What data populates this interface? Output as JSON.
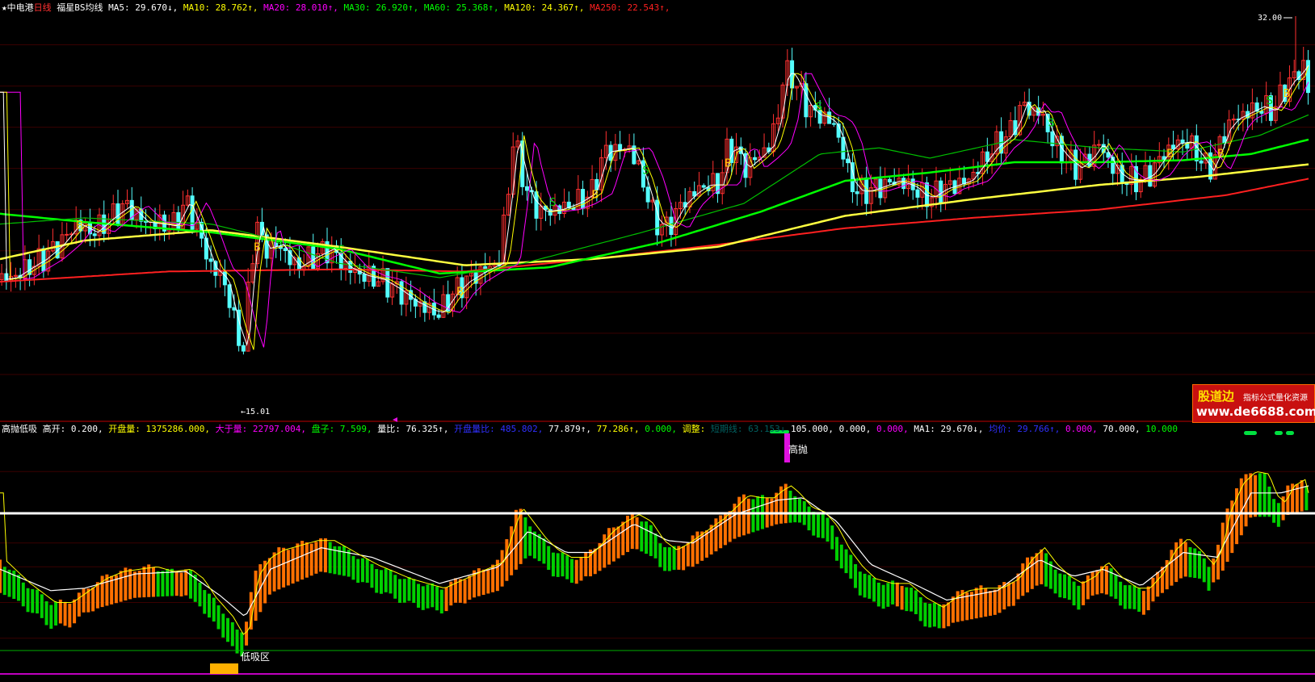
{
  "main_header": {
    "star": "★",
    "stock": "中电港",
    "period": "日线",
    "indicator": "福星BS均线",
    "items": [
      {
        "label": "MA5: 29.670↓,",
        "color": "#ffffff"
      },
      {
        "label": "MA10: 28.762↑,",
        "color": "#ffff00"
      },
      {
        "label": "MA20: 28.010↑,",
        "color": "#ff00ff"
      },
      {
        "label": "MA30: 26.920↑,",
        "color": "#00ff00"
      },
      {
        "label": "MA60: 25.368↑,",
        "color": "#00ff00"
      },
      {
        "label": "MA120: 24.367↑,",
        "color": "#ffff00"
      },
      {
        "label": "MA250: 22.543↑,",
        "color": "#ff2020"
      }
    ]
  },
  "sub_header": {
    "items": [
      {
        "label": "高抛低吸",
        "color": "#ffffff"
      },
      {
        "label": " 高开: 0.200,",
        "color": "#ffffff"
      },
      {
        "label": " 开盘量: 1375286.000,",
        "color": "#ffff00"
      },
      {
        "label": " 大于量: 22797.004,",
        "color": "#ff00ff"
      },
      {
        "label": " 盘子: 7.599,",
        "color": "#00ff00"
      },
      {
        "label": " 量比: 76.325↑,",
        "color": "#ffffff"
      },
      {
        "label": " 开盘量比: 485.802,",
        "color": "#3030ff"
      },
      {
        "label": " 77.879↑,",
        "color": "#ffffff"
      },
      {
        "label": " 77.286↑,",
        "color": "#ffff00"
      },
      {
        "label": " 0.000,",
        "color": "#00ff00"
      },
      {
        "label": " 调整:",
        "color": "#ffff00"
      },
      {
        "label": " 短期线: 63.153↓",
        "color": "#006060"
      },
      {
        "label": " 105.000,",
        "color": "#ffffff"
      },
      {
        "label": " 0.000,",
        "color": "#ffffff"
      },
      {
        "label": " 0.000,",
        "color": "#ff00ff"
      },
      {
        "label": " MA1: 29.670↓,",
        "color": "#ffffff"
      },
      {
        "label": " 均价: 29.766↑,",
        "color": "#3030ff"
      },
      {
        "label": " 0.000,",
        "color": "#ff00ff"
      },
      {
        "label": " 70.000,",
        "color": "#ffffff"
      },
      {
        "label": " 10.000",
        "color": "#00ff00"
      }
    ]
  },
  "watermark": {
    "line1": "股道边",
    "line2": "指标公式量化资源",
    "line3": "www.de6688.com"
  },
  "chart_data": [
    {
      "type": "candlestick",
      "title": "福星BS均线",
      "ylim": [
        14,
        33
      ],
      "annotations": {
        "high_label": "32.00",
        "low_label": "←15.01",
        "buy_marker": "B",
        "sell_marker": "S"
      },
      "series": [
        {
          "name": "MA5",
          "value": 29.67,
          "color": "#ffffff"
        },
        {
          "name": "MA10",
          "value": 28.762,
          "color": "#ffff00"
        },
        {
          "name": "MA20",
          "value": 28.01,
          "color": "#ff00ff"
        },
        {
          "name": "MA30",
          "value": 26.92,
          "color": "#00ff00"
        },
        {
          "name": "MA60",
          "value": 25.368,
          "color": "#00ff00"
        },
        {
          "name": "MA120",
          "value": 24.367,
          "color": "#ffff00"
        },
        {
          "name": "MA250",
          "value": 22.543,
          "color": "#ff2020"
        }
      ],
      "close_path": [
        [
          0,
          20.6
        ],
        [
          15,
          20.7
        ],
        [
          30,
          21.1
        ],
        [
          50,
          21.6
        ],
        [
          70,
          22.3
        ],
        [
          90,
          23.3
        ],
        [
          110,
          22.9
        ],
        [
          130,
          23.6
        ],
        [
          150,
          24.2
        ],
        [
          170,
          23.4
        ],
        [
          190,
          23.3
        ],
        [
          205,
          23.2
        ],
        [
          220,
          24.4
        ],
        [
          235,
          22.9
        ],
        [
          250,
          21.2
        ],
        [
          265,
          20.6
        ],
        [
          278,
          18.4
        ],
        [
          288,
          17.2
        ],
        [
          297,
          21.6
        ],
        [
          305,
          23.3
        ],
        [
          312,
          22.1
        ],
        [
          330,
          22.3
        ],
        [
          350,
          21.2
        ],
        [
          370,
          21.7
        ],
        [
          390,
          22.1
        ],
        [
          410,
          21.2
        ],
        [
          430,
          20.8
        ],
        [
          450,
          20.6
        ],
        [
          470,
          20.1
        ],
        [
          490,
          19.5
        ],
        [
          510,
          19.1
        ],
        [
          520,
          19.0
        ],
        [
          535,
          19.9
        ],
        [
          550,
          20.5
        ],
        [
          570,
          21.0
        ],
        [
          590,
          21.4
        ],
        [
          600,
          24.5
        ],
        [
          608,
          27.6
        ],
        [
          615,
          26.2
        ],
        [
          625,
          24.6
        ],
        [
          640,
          23.9
        ],
        [
          660,
          24.0
        ],
        [
          680,
          24.3
        ],
        [
          700,
          24.8
        ],
        [
          715,
          26.8
        ],
        [
          730,
          26.9
        ],
        [
          745,
          27.0
        ],
        [
          760,
          25.5
        ],
        [
          775,
          23.4
        ],
        [
          790,
          23.1
        ],
        [
          805,
          24.2
        ],
        [
          820,
          24.8
        ],
        [
          835,
          25.2
        ],
        [
          850,
          25.2
        ],
        [
          860,
          26.8
        ],
        [
          870,
          27.0
        ],
        [
          880,
          26.0
        ],
        [
          895,
          26.5
        ],
        [
          910,
          27.1
        ],
        [
          920,
          28.5
        ],
        [
          927,
          30.6
        ],
        [
          935,
          30.6
        ],
        [
          945,
          29.8
        ],
        [
          955,
          29.0
        ],
        [
          965,
          28.6
        ],
        [
          975,
          28.5
        ],
        [
          985,
          28.2
        ],
        [
          995,
          27.2
        ],
        [
          1005,
          25.4
        ],
        [
          1015,
          24.9
        ],
        [
          1025,
          24.9
        ],
        [
          1040,
          25.1
        ],
        [
          1060,
          25.4
        ],
        [
          1080,
          25.1
        ],
        [
          1090,
          24.7
        ],
        [
          1100,
          24.6
        ],
        [
          1115,
          25.0
        ],
        [
          1130,
          25.2
        ],
        [
          1145,
          25.4
        ],
        [
          1160,
          26.2
        ],
        [
          1175,
          27.0
        ],
        [
          1190,
          27.5
        ],
        [
          1200,
          28.1
        ],
        [
          1210,
          29.2
        ],
        [
          1220,
          28.7
        ],
        [
          1230,
          28.8
        ],
        [
          1240,
          27.8
        ],
        [
          1250,
          27.0
        ],
        [
          1260,
          26.5
        ],
        [
          1275,
          26.0
        ],
        [
          1290,
          26.6
        ],
        [
          1300,
          27.2
        ],
        [
          1310,
          26.5
        ],
        [
          1320,
          25.8
        ],
        [
          1330,
          25.5
        ],
        [
          1345,
          25.4
        ],
        [
          1360,
          25.7
        ],
        [
          1375,
          26.6
        ],
        [
          1390,
          27.2
        ],
        [
          1405,
          27.3
        ],
        [
          1420,
          26.5
        ],
        [
          1430,
          25.9
        ],
        [
          1440,
          26.8
        ],
        [
          1450,
          27.9
        ],
        [
          1460,
          28.4
        ],
        [
          1475,
          28.7
        ],
        [
          1490,
          29.0
        ],
        [
          1505,
          28.8
        ],
        [
          1515,
          29.5
        ],
        [
          1525,
          30.2
        ],
        [
          1535,
          30.6
        ],
        [
          1542,
          31.0
        ],
        [
          1548,
          29.7
        ]
      ],
      "ma120_path": [
        [
          0,
          21.6
        ],
        [
          100,
          22.5
        ],
        [
          250,
          23.0
        ],
        [
          400,
          22.2
        ],
        [
          550,
          21.3
        ],
        [
          700,
          21.6
        ],
        [
          850,
          22.2
        ],
        [
          1000,
          23.7
        ],
        [
          1150,
          24.5
        ],
        [
          1300,
          25.2
        ],
        [
          1420,
          25.6
        ],
        [
          1548,
          26.2
        ]
      ],
      "ma250_path": [
        [
          0,
          20.5
        ],
        [
          200,
          21.0
        ],
        [
          400,
          21.1
        ],
        [
          550,
          21.0
        ],
        [
          700,
          21.6
        ],
        [
          850,
          22.3
        ],
        [
          1000,
          23.1
        ],
        [
          1150,
          23.6
        ],
        [
          1300,
          24.0
        ],
        [
          1450,
          24.7
        ],
        [
          1548,
          25.5
        ]
      ],
      "ma60_path": [
        [
          0,
          23.8
        ],
        [
          100,
          23.4
        ],
        [
          250,
          22.9
        ],
        [
          400,
          22.1
        ],
        [
          520,
          20.9
        ],
        [
          650,
          21.2
        ],
        [
          780,
          22.4
        ],
        [
          900,
          23.9
        ],
        [
          1000,
          25.4
        ],
        [
          1100,
          25.8
        ],
        [
          1200,
          26.3
        ],
        [
          1300,
          26.3
        ],
        [
          1400,
          26.4
        ],
        [
          1480,
          26.7
        ],
        [
          1548,
          27.4
        ]
      ],
      "ma30_path": [
        [
          0,
          23.3
        ],
        [
          100,
          23.6
        ],
        [
          250,
          23.3
        ],
        [
          300,
          22.8
        ],
        [
          400,
          21.4
        ],
        [
          520,
          20.7
        ],
        [
          620,
          21.4
        ],
        [
          760,
          22.9
        ],
        [
          880,
          24.3
        ],
        [
          970,
          26.7
        ],
        [
          1040,
          27.0
        ],
        [
          1100,
          26.5
        ],
        [
          1200,
          27.4
        ],
        [
          1300,
          27.0
        ],
        [
          1400,
          26.8
        ],
        [
          1490,
          27.6
        ],
        [
          1548,
          28.6
        ]
      ]
    },
    {
      "type": "bar",
      "title": "高抛低吸",
      "ylim": [
        0,
        100
      ],
      "reference_lines": {
        "high": 70.0,
        "low": 10.0
      },
      "labels": {
        "top": "高抛",
        "bottom": "低吸区"
      },
      "values_path": [
        [
          0,
          48
        ],
        [
          30,
          38
        ],
        [
          60,
          30
        ],
        [
          80,
          30
        ],
        [
          100,
          35
        ],
        [
          120,
          40
        ],
        [
          140,
          43
        ],
        [
          160,
          44
        ],
        [
          180,
          45
        ],
        [
          200,
          43
        ],
        [
          220,
          44
        ],
        [
          235,
          40
        ],
        [
          250,
          32
        ],
        [
          270,
          24
        ],
        [
          283,
          16
        ],
        [
          290,
          20
        ],
        [
          300,
          41
        ],
        [
          315,
          49
        ],
        [
          330,
          52
        ],
        [
          350,
          54
        ],
        [
          370,
          56
        ],
        [
          390,
          56
        ],
        [
          410,
          52
        ],
        [
          440,
          46
        ],
        [
          480,
          40
        ],
        [
          520,
          36
        ],
        [
          545,
          40
        ],
        [
          570,
          44
        ],
        [
          590,
          47
        ],
        [
          600,
          58
        ],
        [
          612,
          70
        ],
        [
          625,
          64
        ],
        [
          640,
          57
        ],
        [
          655,
          52
        ],
        [
          670,
          49
        ],
        [
          690,
          49
        ],
        [
          705,
          54
        ],
        [
          720,
          60
        ],
        [
          735,
          64
        ],
        [
          750,
          67
        ],
        [
          765,
          64
        ],
        [
          780,
          56
        ],
        [
          795,
          52
        ],
        [
          810,
          55
        ],
        [
          830,
          60
        ],
        [
          850,
          65
        ],
        [
          865,
          70
        ],
        [
          880,
          75
        ],
        [
          895,
          74
        ],
        [
          910,
          74
        ],
        [
          920,
          77
        ],
        [
          930,
          79
        ],
        [
          940,
          76
        ],
        [
          955,
          70
        ],
        [
          970,
          68
        ],
        [
          985,
          62
        ],
        [
          1000,
          52
        ],
        [
          1015,
          45
        ],
        [
          1030,
          40
        ],
        [
          1050,
          38
        ],
        [
          1070,
          38
        ],
        [
          1090,
          32
        ],
        [
          1110,
          28
        ],
        [
          1125,
          32
        ],
        [
          1140,
          35
        ],
        [
          1160,
          36
        ],
        [
          1180,
          36
        ],
        [
          1200,
          40
        ],
        [
          1215,
          48
        ],
        [
          1230,
          53
        ],
        [
          1245,
          46
        ],
        [
          1260,
          41
        ],
        [
          1275,
          38
        ],
        [
          1290,
          41
        ],
        [
          1305,
          47
        ],
        [
          1320,
          41
        ],
        [
          1340,
          36
        ],
        [
          1355,
          36
        ],
        [
          1370,
          42
        ],
        [
          1385,
          52
        ],
        [
          1400,
          57
        ],
        [
          1415,
          52
        ],
        [
          1430,
          46
        ],
        [
          1440,
          52
        ],
        [
          1450,
          68
        ],
        [
          1465,
          80
        ],
        [
          1480,
          85
        ],
        [
          1495,
          84
        ],
        [
          1505,
          75
        ],
        [
          1515,
          72
        ],
        [
          1525,
          79
        ],
        [
          1540,
          82
        ],
        [
          1548,
          76
        ]
      ],
      "ma_path": [
        [
          0,
          44
        ],
        [
          60,
          35
        ],
        [
          100,
          36
        ],
        [
          160,
          42
        ],
        [
          220,
          43
        ],
        [
          260,
          33
        ],
        [
          290,
          24
        ],
        [
          320,
          44
        ],
        [
          380,
          53
        ],
        [
          440,
          49
        ],
        [
          520,
          38
        ],
        [
          590,
          45
        ],
        [
          625,
          60
        ],
        [
          670,
          51
        ],
        [
          700,
          51
        ],
        [
          750,
          63
        ],
        [
          790,
          56
        ],
        [
          820,
          55
        ],
        [
          870,
          67
        ],
        [
          920,
          73
        ],
        [
          950,
          74
        ],
        [
          990,
          64
        ],
        [
          1030,
          46
        ],
        [
          1080,
          38
        ],
        [
          1120,
          31
        ],
        [
          1180,
          35
        ],
        [
          1230,
          48
        ],
        [
          1270,
          41
        ],
        [
          1305,
          44
        ],
        [
          1350,
          37
        ],
        [
          1400,
          51
        ],
        [
          1440,
          49
        ],
        [
          1480,
          76
        ],
        [
          1515,
          76
        ],
        [
          1548,
          79
        ]
      ]
    }
  ]
}
